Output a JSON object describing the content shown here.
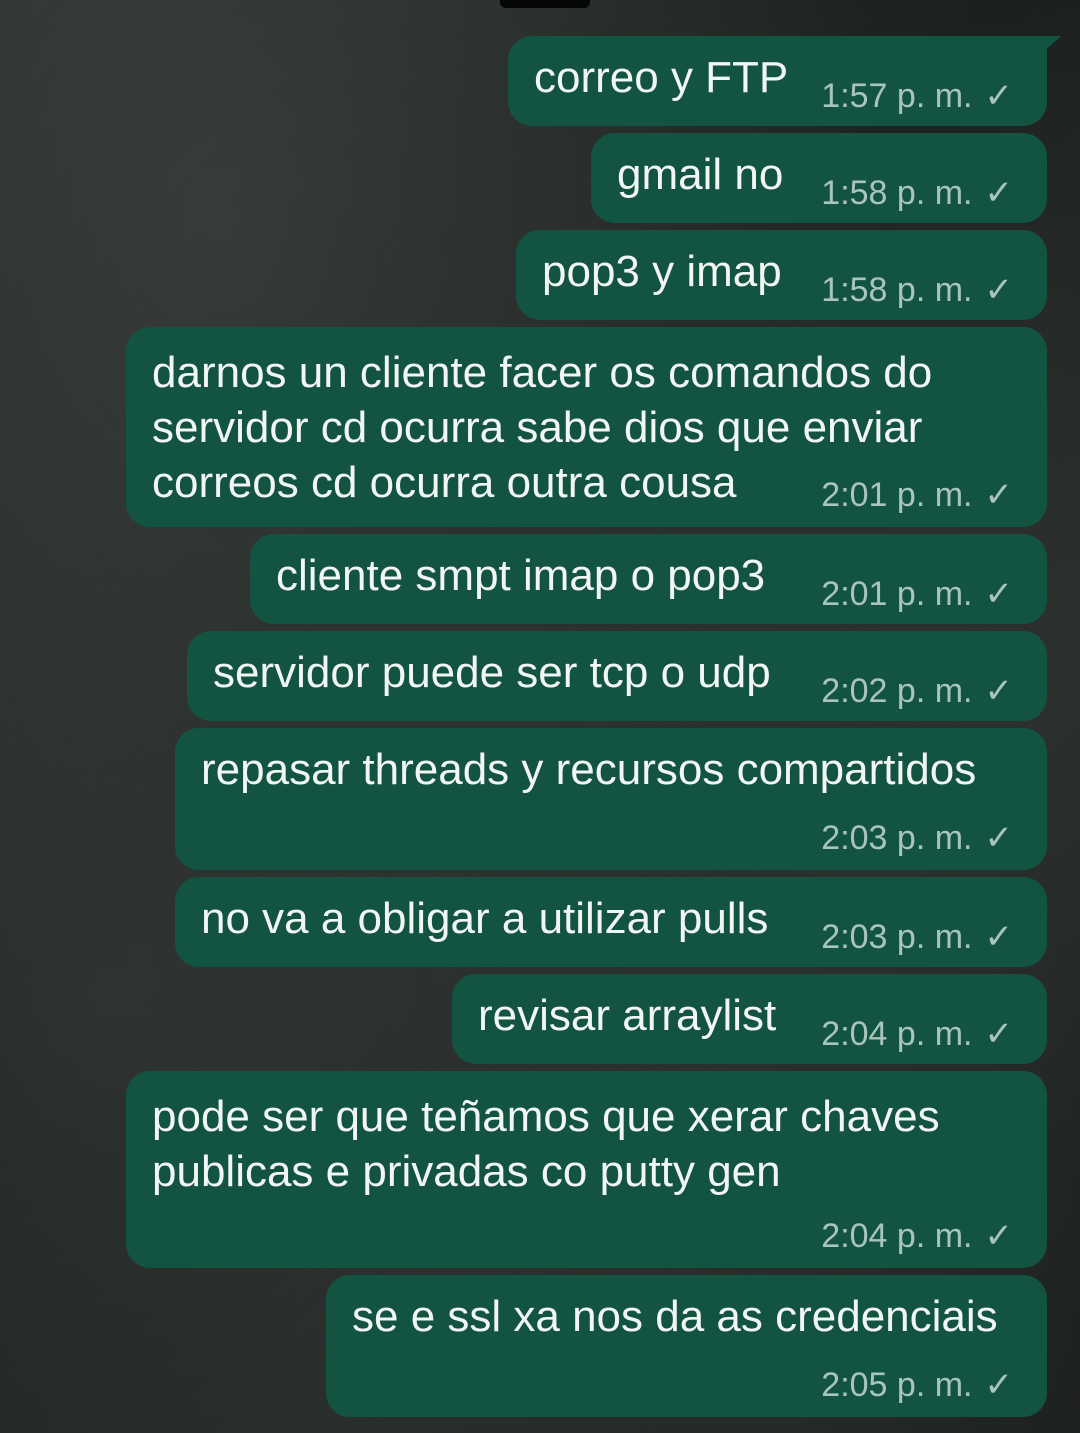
{
  "messages": [
    {
      "text": "correo y FTP",
      "time": "1:57 p. m.",
      "status": "sent-check"
    },
    {
      "text": "gmail no",
      "time": "1:58 p. m.",
      "status": "sent-check"
    },
    {
      "text": "pop3 y imap",
      "time": "1:58 p. m.",
      "status": "sent-check"
    },
    {
      "text": "darnos un cliente facer os comandos do servidor cd ocurra sabe dios que enviar correos cd ocurra outra cousa",
      "time": "2:01 p. m.",
      "status": "sent-check"
    },
    {
      "text": "cliente smpt imap o pop3",
      "time": "2:01 p. m.",
      "status": "sent-check"
    },
    {
      "text": "servidor puede ser tcp o udp",
      "time": "2:02 p. m.",
      "status": "sent-check"
    },
    {
      "text": "repasar threads y recursos compartidos",
      "time": "2:03 p. m.",
      "status": "sent-check"
    },
    {
      "text": "no va a obligar a utilizar pulls",
      "time": "2:03 p. m.",
      "status": "sent-check"
    },
    {
      "text": "revisar arraylist",
      "time": "2:04 p. m.",
      "status": "sent-check"
    },
    {
      "text": "pode ser que teñamos que xerar chaves publicas e privadas co putty gen",
      "time": "2:04 p. m.",
      "status": "sent-check"
    },
    {
      "text": "se e ssl xa nos da as credenciais",
      "time": "2:05 p. m.",
      "status": "sent-check"
    }
  ],
  "icons": {
    "check": "✓"
  },
  "colors": {
    "bubble": "#135342",
    "text": "#f1f5f3",
    "meta": "#a9c4bb"
  }
}
